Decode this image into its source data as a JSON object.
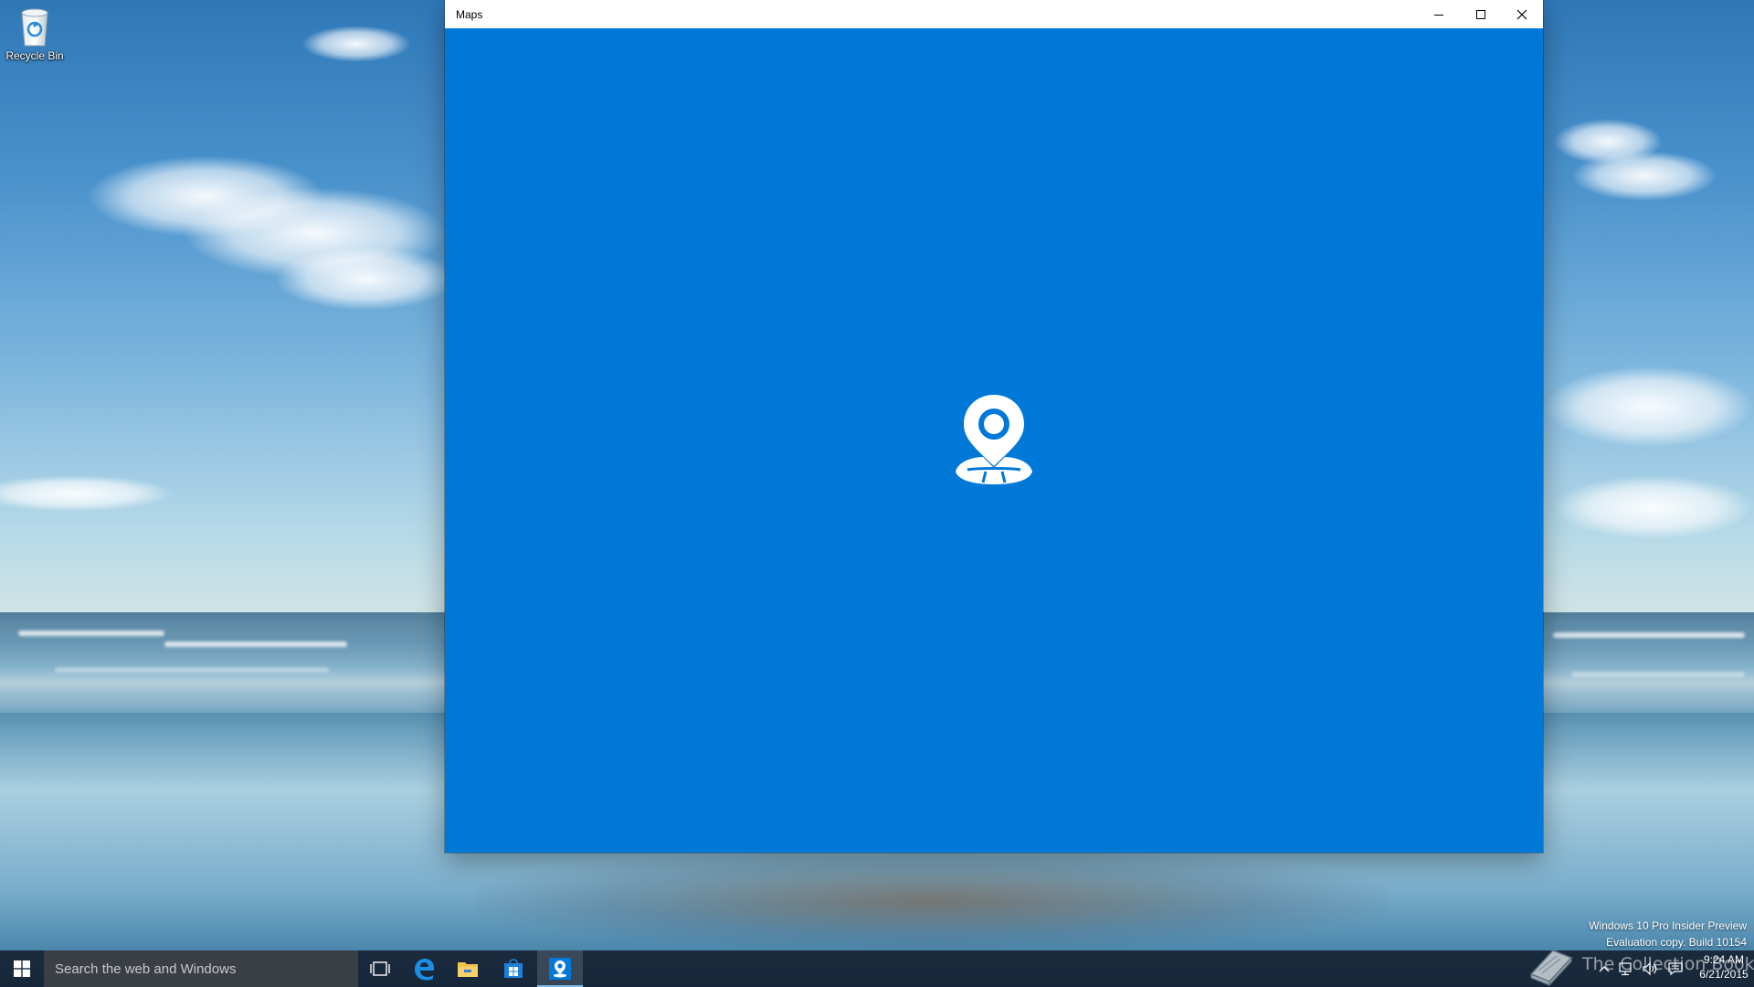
{
  "desktop": {
    "icons": [
      {
        "label": "Recycle Bin",
        "icon": "recycle-bin-icon"
      }
    ],
    "watermark": {
      "line1": "Windows 10 Pro Insider Preview",
      "line2": "Evaluation copy. Build 10154"
    },
    "brand_overlay": "The Collection Book"
  },
  "window": {
    "title": "Maps",
    "controls": {
      "minimize": "minimize-icon",
      "maximize": "maximize-icon",
      "close": "close-icon"
    },
    "background_color": "#0078d7",
    "splash_icon": "maps-location-pin-icon"
  },
  "taskbar": {
    "background_color": "#1e2835",
    "search": {
      "placeholder": "Search the web and Windows"
    },
    "pinned": [
      {
        "name": "Task View",
        "icon": "task-view-icon"
      },
      {
        "name": "Microsoft Edge",
        "icon": "edge-icon"
      },
      {
        "name": "File Explorer",
        "icon": "folder-icon"
      },
      {
        "name": "Store",
        "icon": "store-icon"
      },
      {
        "name": "Maps",
        "icon": "maps-icon",
        "active": true
      }
    ],
    "tray": {
      "icons": [
        "chevron-up-icon",
        "network-icon",
        "volume-icon",
        "action-center-icon"
      ],
      "time": "9:24 AM",
      "date": "6/21/2015"
    }
  }
}
